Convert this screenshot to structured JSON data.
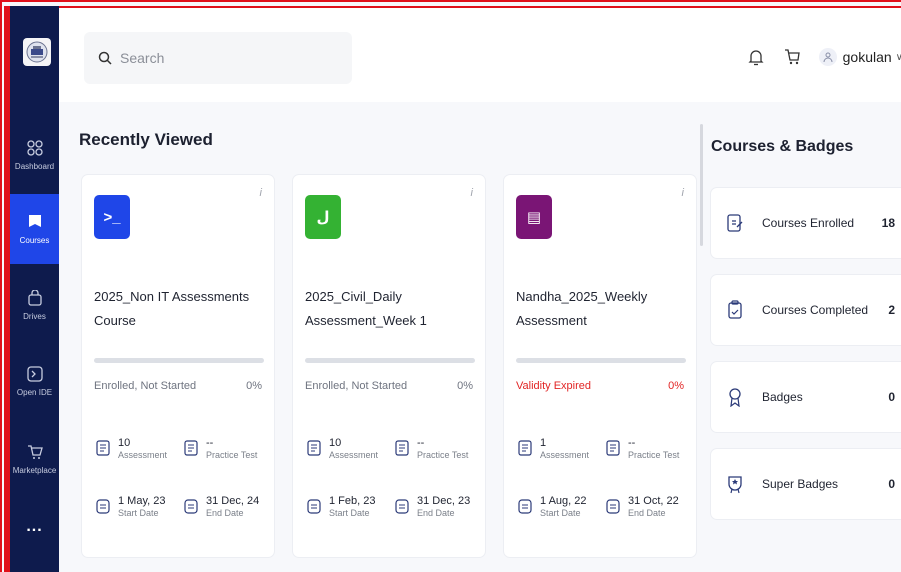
{
  "sidebar": {
    "items": [
      {
        "label": "Dashboard",
        "icon": "grid-icon"
      },
      {
        "label": "Courses",
        "icon": "book-icon",
        "active": true
      },
      {
        "label": "Drives",
        "icon": "bag-icon"
      },
      {
        "label": "Open IDE",
        "icon": "terminal-icon"
      },
      {
        "label": "Marketplace",
        "icon": "cart-icon"
      }
    ],
    "more": "..."
  },
  "header": {
    "search_placeholder": "Search",
    "username": "gokulan",
    "caret": "∨"
  },
  "main": {
    "section_title": "Recently Viewed",
    "cards": [
      {
        "tile_glyph": ">_",
        "tile_color": "#1f46e8",
        "title": "2025_Non IT Assessments Course",
        "status": "Enrolled, Not Started",
        "percent": "0%",
        "progress": 0,
        "assessment_count": "10",
        "assessment_label": "Assessment",
        "practice_count": "--",
        "practice_label": "Practice Test",
        "start_date": "1 May, 23",
        "start_label": "Start Date",
        "end_date": "31 Dec, 24",
        "end_label": "End Date"
      },
      {
        "tile_glyph": "ل",
        "tile_color": "#34b233",
        "title": "2025_Civil_Daily Assessment_Week 1",
        "status": "Enrolled, Not Started",
        "percent": "0%",
        "progress": 0,
        "assessment_count": "10",
        "assessment_label": "Assessment",
        "practice_count": "--",
        "practice_label": "Practice Test",
        "start_date": "1 Feb, 23",
        "start_label": "Start Date",
        "end_date": "31 Dec, 23",
        "end_label": "End Date"
      },
      {
        "tile_glyph": "▤",
        "tile_color": "#7a1575",
        "title": "Nandha_2025_Weekly Assessment",
        "status": "Validity Expired",
        "percent": "0%",
        "progress": 0,
        "expired": true,
        "assessment_count": "1",
        "assessment_label": "Assessment",
        "practice_count": "--",
        "practice_label": "Practice Test",
        "start_date": "1 Aug, 22",
        "start_label": "Start Date",
        "end_date": "31 Oct, 22",
        "end_label": "End Date"
      }
    ],
    "info_glyph": "i"
  },
  "right_panel": {
    "title": "Courses & Badges",
    "items": [
      {
        "label": "Courses Enrolled",
        "value": "18",
        "icon": "enrolled-icon"
      },
      {
        "label": "Courses Completed",
        "value": "2",
        "icon": "completed-icon"
      },
      {
        "label": "Badges",
        "value": "0",
        "icon": "badge-icon"
      },
      {
        "label": "Super Badges",
        "value": "0",
        "icon": "super-badge-icon"
      }
    ]
  }
}
